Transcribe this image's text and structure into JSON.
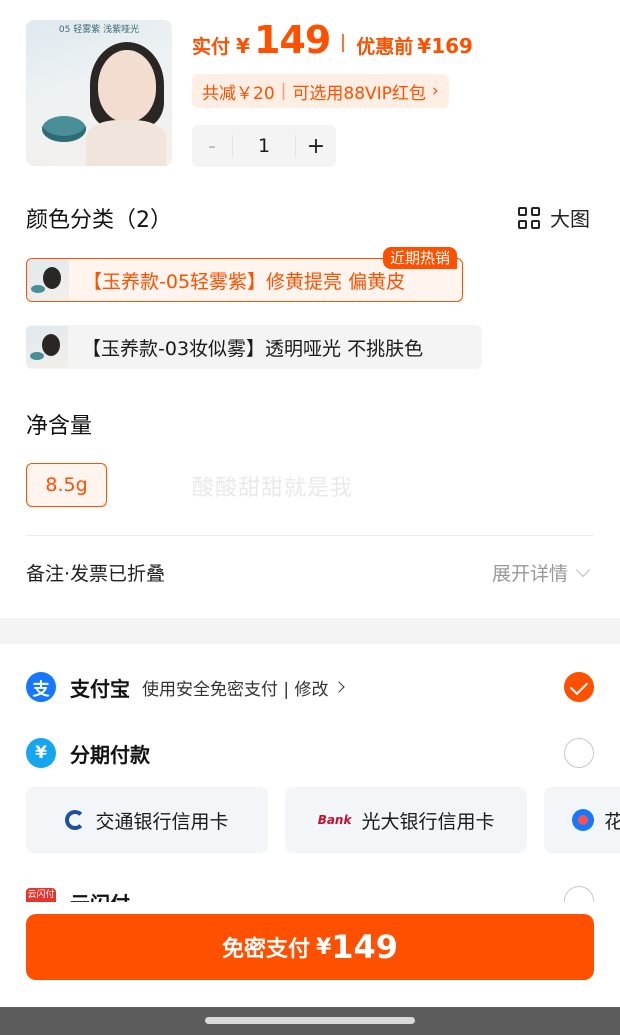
{
  "product": {
    "thumb_caption": "05 轻雾紫 浅紫哑光"
  },
  "price": {
    "actual_label": "实付",
    "currency": "¥",
    "actual_value": "149",
    "pre_discount_label": "优惠前",
    "pre_discount_value": "¥169"
  },
  "discount": {
    "total_reduce": "共减￥20",
    "separator": "|",
    "vip_coupon": "可选用88VIP红包",
    "arrow": "›"
  },
  "quantity": {
    "minus": "-",
    "value": "1",
    "plus": "+"
  },
  "color_section": {
    "title": "颜色分类（2）",
    "big_view_label": "大图",
    "hot_badge": "近期热销",
    "variants": [
      {
        "label": "【玉养款-05轻雾紫】修黄提亮 偏黄皮",
        "selected": true
      },
      {
        "label": "【玉养款-03妆似雾】透明哑光 不挑肤色",
        "selected": false
      }
    ]
  },
  "net_content": {
    "title": "净含量",
    "option": "8.5g",
    "watermark": "酸酸甜甜就是我"
  },
  "remark": {
    "label": "备注·发票已折叠",
    "expand_label": "展开详情"
  },
  "payment": {
    "alipay": {
      "icon_char": "支",
      "name": "支付宝",
      "desc": "使用安全免密支付 | 修改",
      "checked": true
    },
    "installment": {
      "icon_char": "¥",
      "name": "分期付款",
      "checked": false
    },
    "cards": [
      {
        "icon": "bocom-icon",
        "label": "交通银行信用卡"
      },
      {
        "icon": "ceb-icon",
        "icon_text": "Bank",
        "label": "光大银行信用卡"
      },
      {
        "icon": "huabei-icon",
        "label": "花"
      }
    ],
    "unionpay": {
      "icon_text": "云闪付",
      "name": "云闪付"
    }
  },
  "pay_button": {
    "label": "免密支付",
    "currency": "¥",
    "amount": "149"
  },
  "colors": {
    "accent": "#ff5000",
    "accent_bg": "#fff4ee",
    "alipay_blue": "#1677ff",
    "installment_blue": "#16a6f0"
  }
}
